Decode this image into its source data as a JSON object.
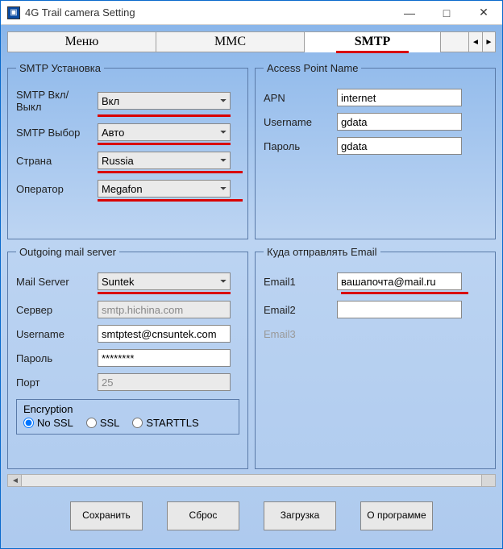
{
  "window": {
    "title": "4G Trail camera Setting"
  },
  "tabs": {
    "menu": "Меню",
    "mmc": "MMC",
    "smtp": "SMTP"
  },
  "smtp_setup": {
    "legend": "SMTP Установка",
    "on_off_label": "SMTP Вкл/Выкл",
    "on_off_value": "Вкл",
    "select_label": "SMTP Выбор",
    "select_value": "Авто",
    "country_label": "Страна",
    "country_value": "Russia",
    "operator_label": "Оператор",
    "operator_value": "Megafon"
  },
  "apn": {
    "legend": "Access Point Name",
    "apn_label": "APN",
    "apn_value": "internet",
    "user_label": "Username",
    "user_value": "gdata",
    "pass_label": "Пароль",
    "pass_value": "gdata"
  },
  "outgoing": {
    "legend": "Outgoing mail server",
    "mailserver_label": "Mail Server",
    "mailserver_value": "Suntek",
    "server_label": "Сервер",
    "server_value": "smtp.hichina.com",
    "user_label": "Username",
    "user_value": "smtptest@cnsuntek.com",
    "pass_label": "Пароль",
    "pass_value": "********",
    "port_label": "Порт",
    "port_value": "25",
    "enc_label": "Encryption",
    "enc_nossl": "No SSL",
    "enc_ssl": "SSL",
    "enc_starttls": "STARTTLS"
  },
  "recipients": {
    "legend": "Куда отправлять Email",
    "email1_label": "Email1",
    "email1_value": "вашапочта@mail.ru",
    "email2_label": "Email2",
    "email2_value": "",
    "email3_label": "Email3",
    "email3_value": ""
  },
  "footer": {
    "save": "Сохранить",
    "reset": "Сброс",
    "load": "Загрузка",
    "about": "О программе"
  }
}
